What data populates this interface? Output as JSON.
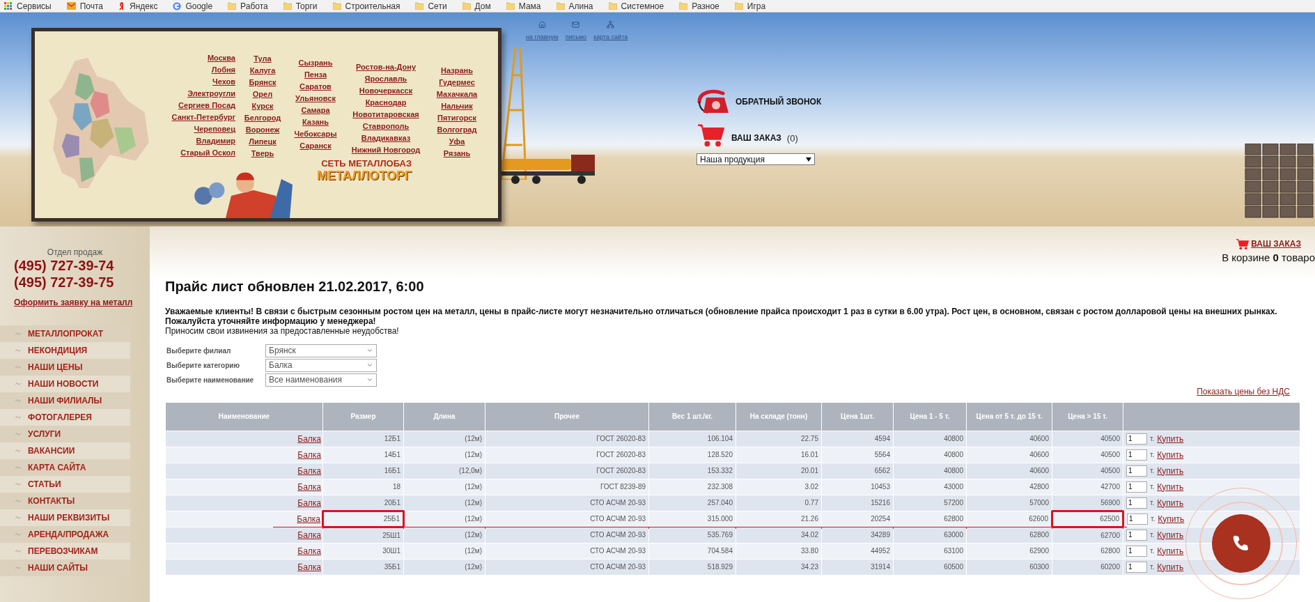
{
  "bookmarks": [
    {
      "label": "Сервисы",
      "kind": "apps"
    },
    {
      "label": "Почта",
      "kind": "mail"
    },
    {
      "label": "Яндекс",
      "kind": "yandex"
    },
    {
      "label": "Google",
      "kind": "google"
    },
    {
      "label": "Работа",
      "kind": "folder"
    },
    {
      "label": "Торги",
      "kind": "folder"
    },
    {
      "label": "Строительная",
      "kind": "folder"
    },
    {
      "label": "Сети",
      "kind": "folder"
    },
    {
      "label": "Дом",
      "kind": "folder"
    },
    {
      "label": "Мама",
      "kind": "folder"
    },
    {
      "label": "Алина",
      "kind": "folder"
    },
    {
      "label": "Системное",
      "kind": "folder"
    },
    {
      "label": "Разное",
      "kind": "folder"
    },
    {
      "label": "Игра",
      "kind": "folder"
    }
  ],
  "header": {
    "nav_links": [
      {
        "label": "на главную",
        "kind": "home"
      },
      {
        "label": "письмо",
        "kind": "mail"
      },
      {
        "label": "карта сайта",
        "kind": "sitemap"
      }
    ],
    "cities": [
      [
        "Москва",
        "Лобня",
        "Чехов",
        "Электроугли",
        "Сергиев Посад",
        "Санкт-Петербург",
        "Череповец",
        "Владимир",
        "Старый Оскол"
      ],
      [
        "Тула",
        "Калуга",
        "Брянск",
        "Орел",
        "Курск",
        "Белгород",
        "Воронеж",
        "Липецк",
        "Тверь"
      ],
      [
        "Сызрань",
        "Пенза",
        "Саратов",
        "Ульяновск",
        "Самара",
        "Казань",
        "Чебоксары",
        "Саранск"
      ],
      [
        "Ростов-на-Дону",
        "Ярославль",
        "Новочеркасск",
        "Краснодар",
        "Новотитаровская",
        "Ставрополь",
        "Владикавказ",
        "Нижний Новгород"
      ],
      [
        "Назрань",
        "Гудермес",
        "Махачкала",
        "Нальчик",
        "Пятигорск",
        "Волгоград",
        "Уфа",
        "Рязань"
      ]
    ],
    "logo": {
      "subtitle": "СЕТЬ МЕТАЛЛОБАЗ",
      "title": "МЕТАЛЛОТОРГ"
    },
    "callback": "ОБРАТНЫЙ ЗВОНОК",
    "order": {
      "label": "ВАШ ЗАКАЗ",
      "count": "(0)"
    },
    "product_select": "Наша продукция"
  },
  "sidebar": {
    "dept": "Отдел продаж",
    "phones": [
      "(495) 727-39-74",
      "(495) 727-39-75"
    ],
    "request_link": "Оформить заявку на металл",
    "menu": [
      "МЕТАЛЛОПРОКАТ",
      "НЕКОНДИЦИЯ",
      "НАШИ ЦЕНЫ",
      "НАШИ НОВОСТИ",
      "НАШИ ФИЛИАЛЫ",
      "ФОТОГАЛЕРЕЯ",
      "УСЛУГИ",
      "ВАКАНСИИ",
      "КАРТА САЙТА",
      "СТАТЬИ",
      "КОНТАКТЫ",
      "НАШИ РЕКВИЗИТЫ",
      "АРЕНДА/ПРОДАЖА",
      "ПЕРЕВОЗЧИКАМ",
      "НАШИ САЙТЫ"
    ]
  },
  "cart": {
    "label": "ВАШ ЗАКАЗ",
    "summary": "В корзине **0** товаро"
  },
  "page": {
    "title": "Прайс лист обновлен 21.02.2017, 6:00",
    "notice": "Уважаемые клиенты! В связи с быстрым сезонным ростом цен на металл, цены в прайс-листе могут незначительно отличаться (обновление прайса происходит 1 раз в сутки в 6.00 утра). Рост цен, в основном, связан с ростом долларовой цены на внешних рынках. Пожалуйста уточняйте информацию у менеджера!",
    "apology": "Приносим свои извинения за предоставленные неудобства!",
    "filters": [
      {
        "label": "Выберите филиал",
        "value": "Брянск"
      },
      {
        "label": "Выберите категорию",
        "value": "Балка"
      },
      {
        "label": "Выберите наименование",
        "value": "Все наименования"
      }
    ],
    "vat_link": "Показать цены без НДС"
  },
  "table": {
    "columns": [
      "Наименование",
      "Размер",
      "Длина",
      "Прочее",
      "Вес 1 шт./кг.",
      "На складе (тонн)",
      "Цена 1шт.",
      "Цена 1 - 5 т.",
      "Цена от 5 т. до 15 т.",
      "Цена > 15 т."
    ],
    "rows": [
      {
        "cells": [
          "Балка",
          "12Б1",
          "(12м)",
          "ГОСТ 26020-83",
          "106.104",
          "22.75",
          "4594",
          "40800",
          "40600",
          "40500"
        ],
        "qty": "1",
        "unit": "т.",
        "buy": "Купить",
        "marked": false
      },
      {
        "cells": [
          "Балка",
          "14Б1",
          "(12м)",
          "ГОСТ 26020-83",
          "128.520",
          "16.01",
          "5564",
          "40800",
          "40600",
          "40500"
        ],
        "qty": "1",
        "unit": "т.",
        "buy": "Купить",
        "marked": false
      },
      {
        "cells": [
          "Балка",
          "16Б1",
          "(12,0м)",
          "ГОСТ 26020-83",
          "153.332",
          "20.01",
          "6562",
          "40800",
          "40600",
          "40500"
        ],
        "qty": "1",
        "unit": "т.",
        "buy": "Купить",
        "marked": false
      },
      {
        "cells": [
          "Балка",
          "18",
          "(12м)",
          "ГОСТ 8239-89",
          "232.308",
          "3.02",
          "10453",
          "43000",
          "42800",
          "42700"
        ],
        "qty": "1",
        "unit": "т.",
        "buy": "Купить",
        "marked": false
      },
      {
        "cells": [
          "Балка",
          "20Б1",
          "(12м)",
          "СТО АСЧМ 20-93",
          "257.040",
          "0.77",
          "15216",
          "57200",
          "57000",
          "56900"
        ],
        "qty": "1",
        "unit": "т.",
        "buy": "Купить",
        "marked": false
      },
      {
        "cells": [
          "Балка",
          "25Б1",
          "(12м)",
          "СТО АСЧМ 20-93",
          "315.000",
          "21.26",
          "20254",
          "62800",
          "62600",
          "62500"
        ],
        "qty": "1",
        "unit": "т.",
        "buy": "Купить",
        "marked": true
      },
      {
        "cells": [
          "Балка",
          "25Ш1",
          "(12м)",
          "СТО АСЧМ 20-93",
          "535.769",
          "34.02",
          "34289",
          "63000",
          "62800",
          "62700"
        ],
        "qty": "1",
        "unit": "т.",
        "buy": "Купить",
        "marked": false
      },
      {
        "cells": [
          "Балка",
          "30Ш1",
          "(12м)",
          "СТО АСЧМ 20-93",
          "704.584",
          "33.80",
          "44952",
          "63100",
          "62900",
          "62800"
        ],
        "qty": "1",
        "unit": "т.",
        "buy": "Купить",
        "marked": false
      },
      {
        "cells": [
          "Балка",
          "35Б1",
          "(12м)",
          "СТО АСЧМ 20-93",
          "518.929",
          "34.23",
          "31914",
          "60500",
          "60300",
          "60200"
        ],
        "qty": "1",
        "unit": "т.",
        "buy": "Купить",
        "marked": false
      }
    ]
  }
}
